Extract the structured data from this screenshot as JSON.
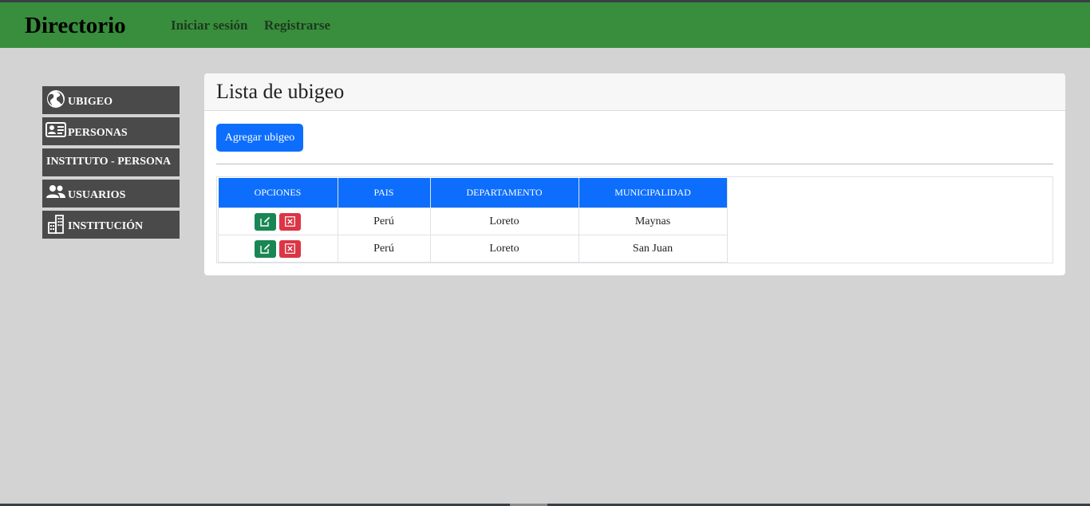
{
  "navbar": {
    "brand": "Directorio",
    "login": "Iniciar sesión",
    "register": "Registrarse"
  },
  "sidebar": {
    "items": [
      {
        "label": "UBIGEO",
        "icon": "globe-icon"
      },
      {
        "label": "PERSONAS",
        "icon": "id-card-icon"
      },
      {
        "label": "INSTITUTO - PERSONA",
        "icon": ""
      },
      {
        "label": "USUARIOS",
        "icon": "users-icon"
      },
      {
        "label": "INSTITUCIÓN",
        "icon": "building-icon"
      }
    ]
  },
  "main": {
    "title": "Lista de ubigeo",
    "add_button": "Agregar ubigeo",
    "table": {
      "headers": [
        "OPCIONES",
        "PAIS",
        "DEPARTAMENTO",
        "MUNICIPALIDAD"
      ],
      "rows": [
        {
          "pais": "Perú",
          "departamento": "Loreto",
          "municipalidad": "Maynas"
        },
        {
          "pais": "Perú",
          "departamento": "Loreto",
          "municipalidad": "San Juan"
        }
      ]
    }
  },
  "colors": {
    "navbar": "#388e3c",
    "sidebar": "#4a4a4a",
    "primary": "#0d6efd",
    "edit": "#198754",
    "delete": "#dc3545",
    "background": "#d3d3d3"
  }
}
